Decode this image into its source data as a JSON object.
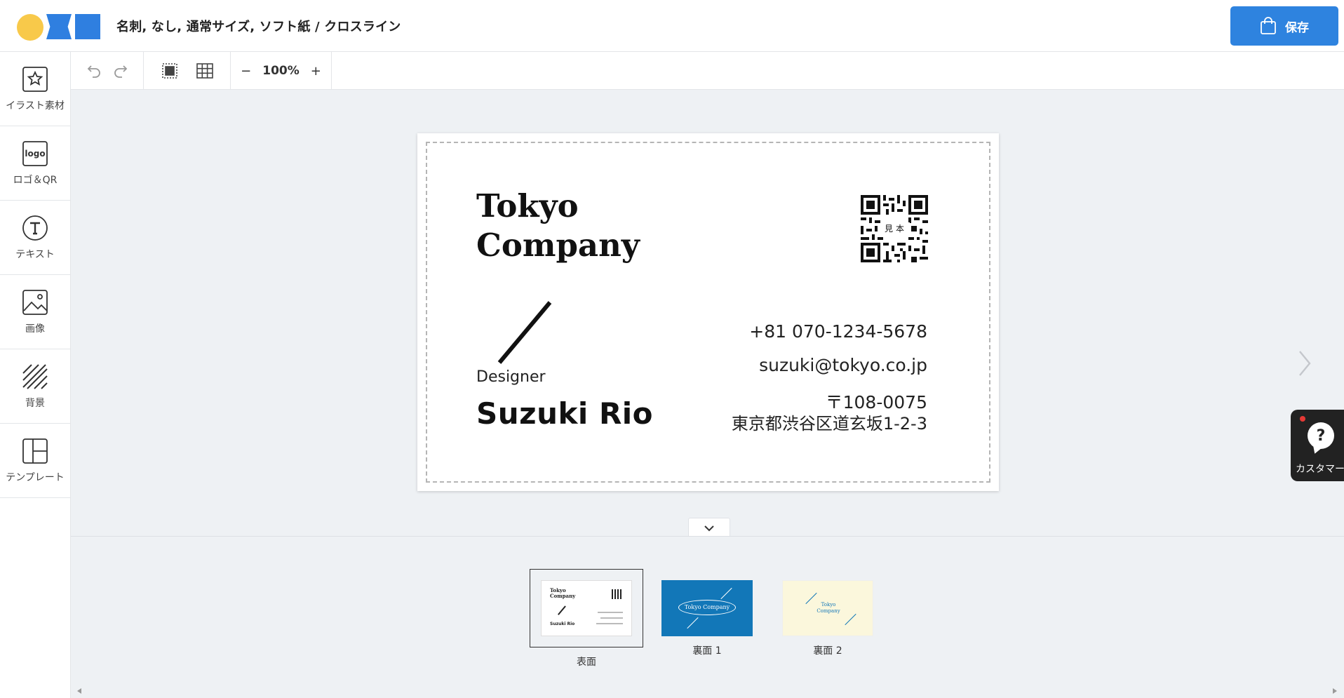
{
  "header": {
    "title": "名刺, なし, 通常サイズ, ソフト紙 / クロスライン",
    "save_label": "保存",
    "accent": "#2e83df"
  },
  "sidebar": {
    "items": [
      {
        "label": "イラスト素材",
        "icon": "star-image-icon"
      },
      {
        "label": "ロゴ＆QR",
        "icon": "logo-icon"
      },
      {
        "label": "テキスト",
        "icon": "text-icon"
      },
      {
        "label": "画像",
        "icon": "image-icon"
      },
      {
        "label": "背景",
        "icon": "hatched-background-icon"
      },
      {
        "label": "テンプレート",
        "icon": "template-icon"
      }
    ],
    "logo_icon_text": "logo"
  },
  "toolbar": {
    "zoom": "100%",
    "zoom_out": "−",
    "zoom_in": "+"
  },
  "card": {
    "company_line1": "Tokyo",
    "company_line2": "Company",
    "role": "Designer",
    "name": "Suzuki Rio",
    "qr_label": "見本",
    "phone": "+81 070-1234-5678",
    "email": "suzuki@tokyo.co.jp",
    "zip": "〒108-0075",
    "address": "東京都渋谷区道玄坂1-2-3"
  },
  "help": {
    "label": "カスタマー"
  },
  "pages": [
    {
      "label": "表面",
      "selected": true,
      "bg": "#ffffff"
    },
    {
      "label": "裏面 1",
      "selected": false,
      "bg": "#1277b8"
    },
    {
      "label": "裏面 2",
      "selected": false,
      "bg": "#fbf7dc"
    }
  ],
  "thumb_text": {
    "front_company_1": "Tokyo",
    "front_company_2": "Company",
    "front_name": "Suzuki Rio",
    "back1_company": "Tokyo Company",
    "back2_company_1": "Tokyo",
    "back2_company_2": "Company"
  }
}
